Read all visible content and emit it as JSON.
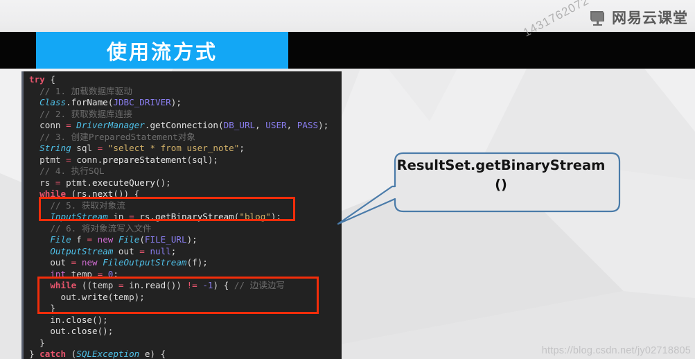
{
  "branding": {
    "logo_text": "网易云课堂",
    "logo_icon": "monitor-icon",
    "user_watermark": "1431762072"
  },
  "slide": {
    "title": "使用流方式",
    "title_bg_color": "#13a7f5",
    "band_color": "#050505"
  },
  "callout": {
    "line1": "ResultSet.getBinaryStream",
    "line2": "()",
    "border_color": "#4a7ba9"
  },
  "highlight": {
    "color": "#f42d0a",
    "box1_label": "获取对象流-highlight",
    "box2_label": "边读边写-highlight"
  },
  "code": {
    "language": "java",
    "background": "#222222",
    "lines": [
      [
        {
          "t": "try",
          "c": "t-kw"
        },
        {
          "t": " {",
          "c": "t-plain"
        }
      ],
      [
        {
          "t": "  // 1. 加载数据库驱动",
          "c": "t-cm"
        }
      ],
      [
        {
          "t": "  ",
          "c": "t-plain"
        },
        {
          "t": "Class",
          "c": "t-type"
        },
        {
          "t": ".",
          "c": "t-plain"
        },
        {
          "t": "forName",
          "c": "t-fn"
        },
        {
          "t": "(",
          "c": "t-plain"
        },
        {
          "t": "JDBC_DRIVER",
          "c": "t-const"
        },
        {
          "t": ");",
          "c": "t-plain"
        }
      ],
      [
        {
          "t": "  // 2. 获取数据库连接",
          "c": "t-cm"
        }
      ],
      [
        {
          "t": "  conn ",
          "c": "t-plain"
        },
        {
          "t": "=",
          "c": "t-op"
        },
        {
          "t": " ",
          "c": "t-plain"
        },
        {
          "t": "DriverManager",
          "c": "t-type"
        },
        {
          "t": ".",
          "c": "t-plain"
        },
        {
          "t": "getConnection",
          "c": "t-fn"
        },
        {
          "t": "(",
          "c": "t-plain"
        },
        {
          "t": "DB_URL",
          "c": "t-const"
        },
        {
          "t": ", ",
          "c": "t-plain"
        },
        {
          "t": "USER",
          "c": "t-const"
        },
        {
          "t": ", ",
          "c": "t-plain"
        },
        {
          "t": "PASS",
          "c": "t-const"
        },
        {
          "t": ");",
          "c": "t-plain"
        }
      ],
      [
        {
          "t": "  // 3. 创建PreparedStatement对象",
          "c": "t-cm"
        }
      ],
      [
        {
          "t": "  ",
          "c": "t-plain"
        },
        {
          "t": "String",
          "c": "t-type"
        },
        {
          "t": " sql ",
          "c": "t-plain"
        },
        {
          "t": "=",
          "c": "t-op"
        },
        {
          "t": " ",
          "c": "t-plain"
        },
        {
          "t": "\"select * from user_note\"",
          "c": "t-str"
        },
        {
          "t": ";",
          "c": "t-plain"
        }
      ],
      [
        {
          "t": "  ptmt ",
          "c": "t-plain"
        },
        {
          "t": "=",
          "c": "t-op"
        },
        {
          "t": " conn.",
          "c": "t-plain"
        },
        {
          "t": "prepareStatement",
          "c": "t-fn"
        },
        {
          "t": "(sql);",
          "c": "t-plain"
        }
      ],
      [
        {
          "t": "  // 4. 执行SQL",
          "c": "t-cm"
        }
      ],
      [
        {
          "t": "  rs ",
          "c": "t-plain"
        },
        {
          "t": "=",
          "c": "t-op"
        },
        {
          "t": " ptmt.",
          "c": "t-plain"
        },
        {
          "t": "executeQuery",
          "c": "t-fn"
        },
        {
          "t": "();",
          "c": "t-plain"
        }
      ],
      [
        {
          "t": "  ",
          "c": "t-plain"
        },
        {
          "t": "while",
          "c": "t-kw"
        },
        {
          "t": " (rs.",
          "c": "t-plain"
        },
        {
          "t": "next",
          "c": "t-fn"
        },
        {
          "t": "()) {",
          "c": "t-plain"
        }
      ],
      [
        {
          "t": "    // 5. 获取对象流",
          "c": "t-cm"
        }
      ],
      [
        {
          "t": "    ",
          "c": "t-plain"
        },
        {
          "t": "InputStream",
          "c": "t-type"
        },
        {
          "t": " in ",
          "c": "t-plain"
        },
        {
          "t": "=",
          "c": "t-op"
        },
        {
          "t": " rs.",
          "c": "t-plain"
        },
        {
          "t": "getBinaryStream",
          "c": "t-fn"
        },
        {
          "t": "(",
          "c": "t-plain"
        },
        {
          "t": "\"blog\"",
          "c": "t-str"
        },
        {
          "t": ");",
          "c": "t-plain"
        }
      ],
      [
        {
          "t": "    // 6. 将对象流写入文件",
          "c": "t-cm"
        }
      ],
      [
        {
          "t": "    ",
          "c": "t-plain"
        },
        {
          "t": "File",
          "c": "t-type"
        },
        {
          "t": " f ",
          "c": "t-plain"
        },
        {
          "t": "=",
          "c": "t-op"
        },
        {
          "t": " ",
          "c": "t-plain"
        },
        {
          "t": "new",
          "c": "t-kw2"
        },
        {
          "t": " ",
          "c": "t-plain"
        },
        {
          "t": "File",
          "c": "t-type"
        },
        {
          "t": "(",
          "c": "t-plain"
        },
        {
          "t": "FILE_URL",
          "c": "t-const"
        },
        {
          "t": ");",
          "c": "t-plain"
        }
      ],
      [
        {
          "t": "    ",
          "c": "t-plain"
        },
        {
          "t": "OutputStream",
          "c": "t-type"
        },
        {
          "t": " out ",
          "c": "t-plain"
        },
        {
          "t": "=",
          "c": "t-op"
        },
        {
          "t": " ",
          "c": "t-plain"
        },
        {
          "t": "null",
          "c": "t-const"
        },
        {
          "t": ";",
          "c": "t-plain"
        }
      ],
      [
        {
          "t": "    out ",
          "c": "t-plain"
        },
        {
          "t": "=",
          "c": "t-op"
        },
        {
          "t": " ",
          "c": "t-plain"
        },
        {
          "t": "new",
          "c": "t-kw2"
        },
        {
          "t": " ",
          "c": "t-plain"
        },
        {
          "t": "FileOutputStream",
          "c": "t-type"
        },
        {
          "t": "(f);",
          "c": "t-plain"
        }
      ],
      [
        {
          "t": "    ",
          "c": "t-plain"
        },
        {
          "t": "int",
          "c": "t-kw2"
        },
        {
          "t": " temp ",
          "c": "t-plain"
        },
        {
          "t": "=",
          "c": "t-op"
        },
        {
          "t": " ",
          "c": "t-plain"
        },
        {
          "t": "0",
          "c": "t-num"
        },
        {
          "t": ";",
          "c": "t-plain"
        }
      ],
      [
        {
          "t": "    ",
          "c": "t-plain"
        },
        {
          "t": "while",
          "c": "t-kw"
        },
        {
          "t": " ((temp ",
          "c": "t-plain"
        },
        {
          "t": "=",
          "c": "t-op"
        },
        {
          "t": " in.",
          "c": "t-plain"
        },
        {
          "t": "read",
          "c": "t-fn"
        },
        {
          "t": "()) ",
          "c": "t-plain"
        },
        {
          "t": "!=",
          "c": "t-op"
        },
        {
          "t": " ",
          "c": "t-plain"
        },
        {
          "t": "-1",
          "c": "t-num"
        },
        {
          "t": ") { ",
          "c": "t-plain"
        },
        {
          "t": "// 边读边写",
          "c": "t-cm"
        }
      ],
      [
        {
          "t": "      out.",
          "c": "t-plain"
        },
        {
          "t": "write",
          "c": "t-fn"
        },
        {
          "t": "(temp);",
          "c": "t-plain"
        }
      ],
      [
        {
          "t": "    }",
          "c": "t-plain"
        }
      ],
      [
        {
          "t": "    in.",
          "c": "t-plain"
        },
        {
          "t": "close",
          "c": "t-fn"
        },
        {
          "t": "();",
          "c": "t-plain"
        }
      ],
      [
        {
          "t": "    out.",
          "c": "t-plain"
        },
        {
          "t": "close",
          "c": "t-fn"
        },
        {
          "t": "();",
          "c": "t-plain"
        }
      ],
      [
        {
          "t": "  }",
          "c": "t-plain"
        }
      ],
      [
        {
          "t": "} ",
          "c": "t-plain"
        },
        {
          "t": "catch",
          "c": "t-kw"
        },
        {
          "t": " (",
          "c": "t-plain"
        },
        {
          "t": "SQLException",
          "c": "t-type"
        },
        {
          "t": " e) {",
          "c": "t-plain"
        }
      ]
    ]
  },
  "footer": {
    "url_watermark": "https://blog.csdn.net/jy02718805"
  }
}
